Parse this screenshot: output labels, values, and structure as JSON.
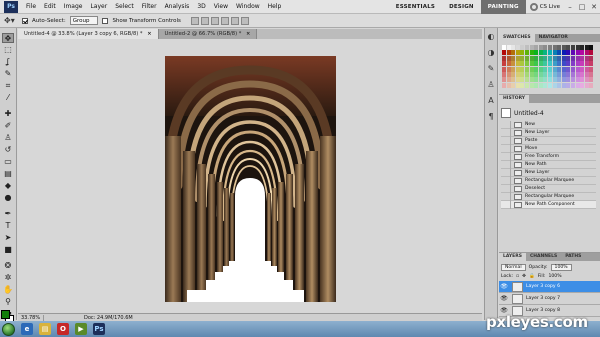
{
  "app": {
    "logo": "Ps"
  },
  "menu": [
    "File",
    "Edit",
    "Image",
    "Layer",
    "Select",
    "Filter",
    "Analysis",
    "3D",
    "View",
    "Window",
    "Help"
  ],
  "workspaces": [
    "ESSENTIALS",
    "DESIGN",
    "PAINTING"
  ],
  "cs_live": "CS Live",
  "window_controls": [
    "–",
    "□",
    "✕"
  ],
  "options": {
    "auto_select_label": "Auto-Select:",
    "auto_select_value": "Group",
    "transform_label": "Show Transform Controls"
  },
  "doc_tabs": [
    {
      "label": "Untitled-4 @ 33.8% (Layer 3 copy 6, RGB/8) *",
      "close": "×"
    },
    {
      "label": "Untitled-2 @ 66.7% (RGB/8) *",
      "close": "×"
    }
  ],
  "status": {
    "zoom": "33.78%",
    "doc": "Doc: 24.9M/170.6M"
  },
  "swatches_panel": {
    "tabs": [
      "SWATCHES",
      "NAVIGATOR"
    ]
  },
  "history_panel": {
    "tab": "HISTORY",
    "snapshot": "Untitled-4",
    "items": [
      "New",
      "New Layer",
      "Paste",
      "Move",
      "Free Transform",
      "New Path",
      "New Layer",
      "Rectangular Marquee",
      "Deselect",
      "Rectangular Marquee",
      "New Path Component"
    ]
  },
  "layers_panel": {
    "tabs": [
      "LAYERS",
      "CHANNELS",
      "PATHS"
    ],
    "blend_mode": "Normal",
    "opacity_label": "Opacity:",
    "opacity_value": "100%",
    "lock_label": "Lock:",
    "fill_label": "Fill:",
    "fill_value": "100%",
    "layers": [
      "Layer 3 copy 6",
      "Layer 3 copy 7",
      "Layer 3 copy 8"
    ],
    "selected_layer": "Layer 3 copy 6"
  },
  "colors": {
    "foreground": "#127d0b",
    "background": "#ffffff",
    "selected_layer": "#3d8ee6"
  },
  "watermark": "pxleyes.com"
}
